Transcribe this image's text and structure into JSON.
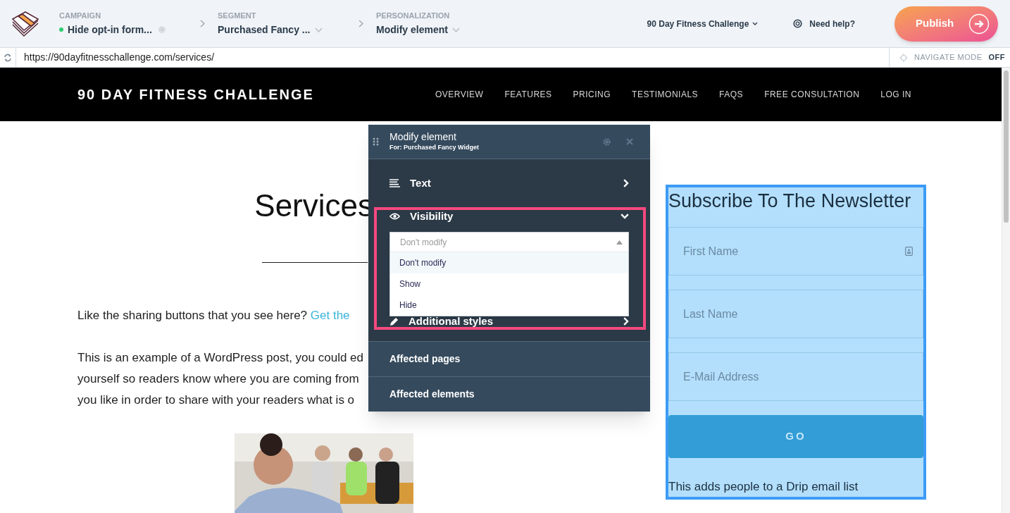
{
  "topbar": {
    "crumbs": [
      {
        "label": "CAMPAIGN",
        "value": "Hide opt-in form...",
        "color": "#2ecc71",
        "kind": "gear"
      },
      {
        "label": "SEGMENT",
        "value": "Purchased Fancy ...",
        "kind": "dropdown"
      },
      {
        "label": "PERSONALIZATION",
        "value": "Modify element",
        "kind": "dropdown"
      }
    ],
    "site_menu": "90 Day Fitness Challenge",
    "help": "Need help?",
    "publish": "Publish"
  },
  "address_bar": {
    "url": "https://90dayfitnesschallenge.com/services/",
    "navigate_mode_label": "NAVIGATE MODE",
    "navigate_mode": "OFF"
  },
  "site": {
    "brand": "90 DAY FITNESS CHALLENGE",
    "nav": [
      "OVERVIEW",
      "FEATURES",
      "PRICING",
      "TESTIMONIALS",
      "FAQS",
      "FREE CONSULTATION",
      "LOG IN"
    ],
    "heading": "Services",
    "intro": "Like the sharing buttons that you see here?",
    "intro_link": "Get the",
    "paragraph_lines": [
      "This is an example of a WordPress post, you could ed",
      "yourself so readers know where you are coming from",
      "you like in order to share with your readers what is o"
    ]
  },
  "newsletter": {
    "title": "Subscribe To The Newsletter",
    "fields": [
      {
        "placeholder": "First Name",
        "autofill_icon": true
      },
      {
        "placeholder": "Last Name",
        "autofill_icon": false
      },
      {
        "placeholder": "E-Mail Address",
        "autofill_icon": false
      }
    ],
    "button": "GO",
    "note": "This adds people to a Drip email list"
  },
  "panel": {
    "title": "Modify element",
    "subtitle": "For: Purchased Fancy Widget",
    "sections": [
      {
        "label": "Text",
        "kind": "text",
        "expanded": false
      },
      {
        "label": "Visibility",
        "kind": "visibility",
        "expanded": true
      },
      {
        "label": "Additional styles",
        "kind": "styles",
        "expanded": false
      }
    ],
    "visibility_select": {
      "placeholder": "Don't modify",
      "options": [
        {
          "label": "Don't modify",
          "selected": true
        },
        {
          "label": "Show",
          "selected": false
        },
        {
          "label": "Hide",
          "selected": false
        }
      ]
    },
    "footer_sections": [
      "Affected pages",
      "Affected elements"
    ]
  }
}
